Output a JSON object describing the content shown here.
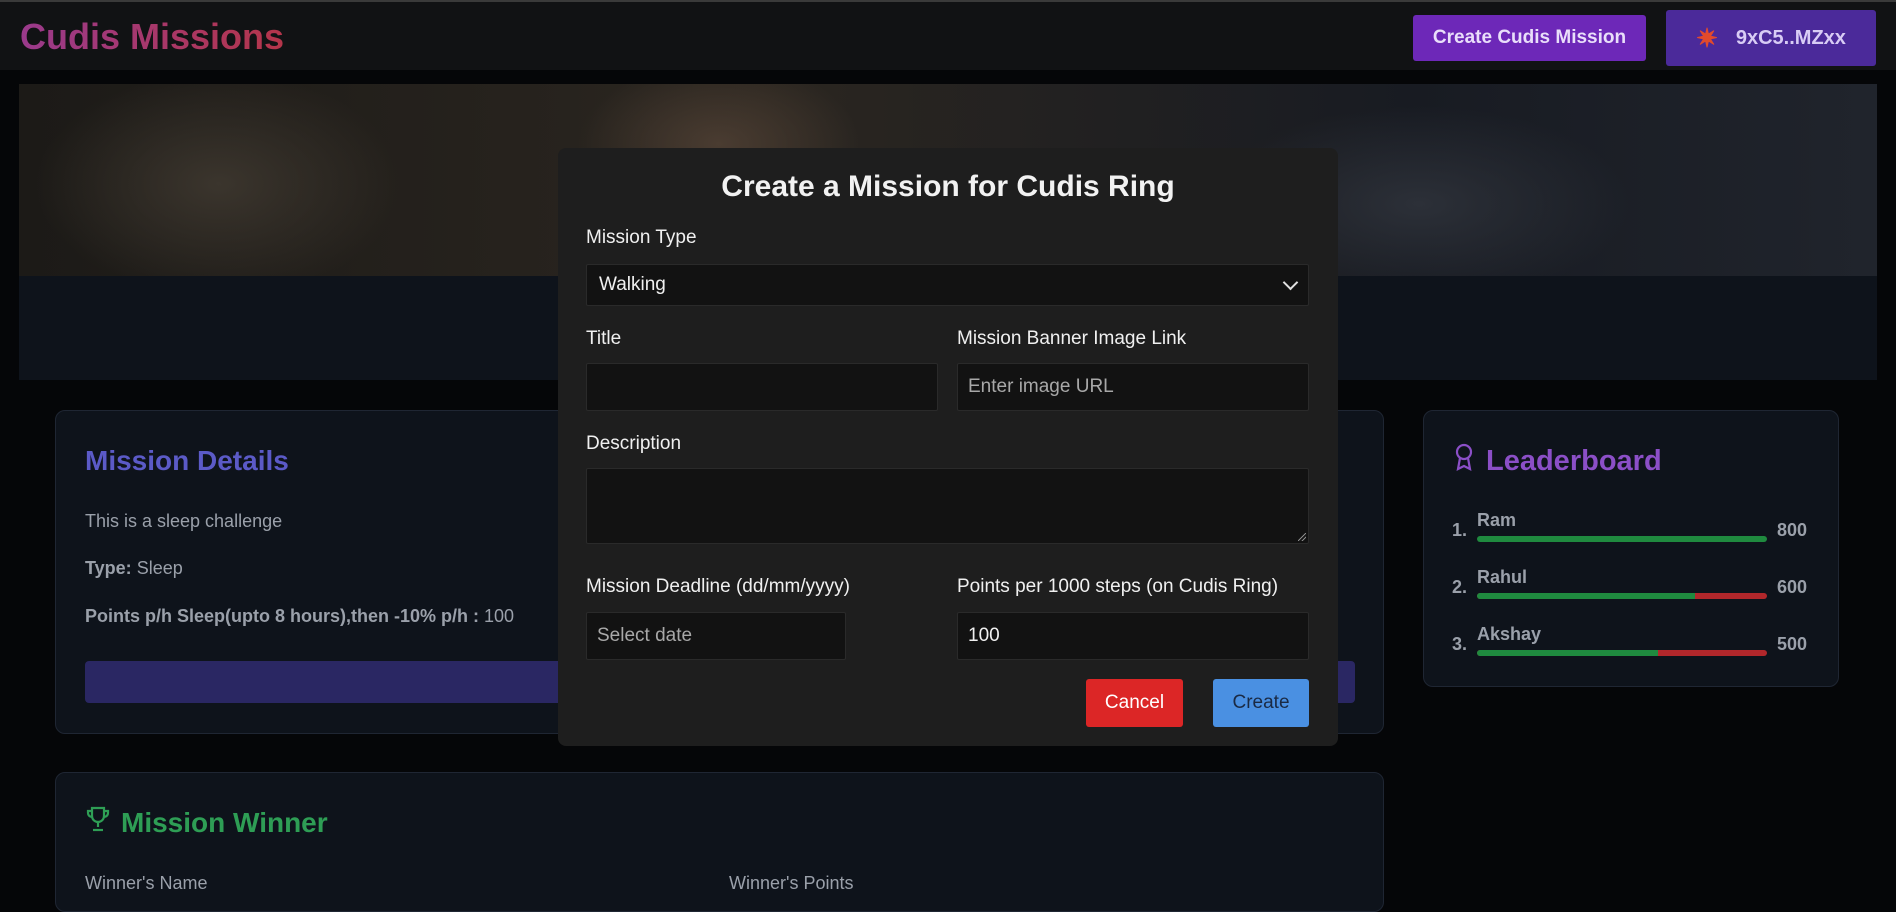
{
  "header": {
    "brand": "Cudis Missions",
    "create_button": "Create Cudis Mission",
    "wallet_address": "9xC5..MZxx",
    "wallet_icon": "starburst-icon"
  },
  "mission_details": {
    "title": "Mission Details",
    "description": "This is a sleep challenge",
    "type_label": "Type:",
    "type_value": "Sleep",
    "points_label": "Points p/h Sleep(upto 8 hours),then -10% p/h :",
    "points_value": "100"
  },
  "mission_winner": {
    "title": "Mission Winner",
    "name_label": "Winner's Name",
    "points_label": "Winner's Points"
  },
  "leaderboard": {
    "title": "Leaderboard",
    "entries": [
      {
        "rank": "1.",
        "name": "Ram",
        "score": "800",
        "progress": 1.0
      },
      {
        "rank": "2.",
        "name": "Rahul",
        "score": "600",
        "progress": 0.75
      },
      {
        "rank": "3.",
        "name": "Akshay",
        "score": "500",
        "progress": 0.625
      }
    ]
  },
  "modal": {
    "title": "Create a Mission for Cudis Ring",
    "mission_type_label": "Mission Type",
    "mission_type_value": "Walking",
    "title_label": "Title",
    "title_value": "",
    "banner_label": "Mission Banner Image Link",
    "banner_placeholder": "Enter image URL",
    "description_label": "Description",
    "deadline_label": "Mission Deadline (dd/mm/yyyy)",
    "deadline_placeholder": "Select date",
    "points_label": "Points per 1000 steps (on Cudis Ring)",
    "points_value": "100",
    "cancel_label": "Cancel",
    "create_label": "Create"
  },
  "colors": {
    "accent_purple": "#6d28b8",
    "cancel_red": "#dc2626",
    "create_blue": "#4a90e2",
    "progress_green": "#1f8a3f",
    "progress_red": "#b1272b"
  }
}
